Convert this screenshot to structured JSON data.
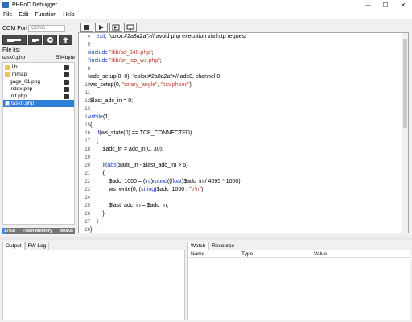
{
  "window": {
    "title": "PHPoC Debugger",
    "controls": {
      "minimize": "—",
      "maximize": "☐",
      "close": "✕"
    }
  },
  "menu": [
    "File",
    "Edit",
    "Function",
    "Help"
  ],
  "sidebar": {
    "com_port_label": "COM Port",
    "com_port_value": "COM5",
    "file_list_label": "File list",
    "project_name": "task0.php",
    "project_size": "534byte",
    "tree": [
      {
        "label": "lib",
        "type": "folder"
      },
      {
        "label": "mmap",
        "type": "folder"
      },
      {
        "label": "gage_01.png",
        "type": "file"
      },
      {
        "label": "index.php",
        "type": "file"
      },
      {
        "label": "init.php",
        "type": "file"
      },
      {
        "label": "task0.php",
        "type": "file",
        "selected": true
      }
    ],
    "memory": {
      "used": "17KB",
      "label": "Flash Memory",
      "total": "460KB",
      "used_fraction": 0.04
    }
  },
  "editor": {
    "lines": [
      {
        "n": "4",
        "code": "    exit; // avoid php execution via http request"
      },
      {
        "n": "5",
        "code": ""
      },
      {
        "n": "6",
        "code": "include \"/lib/sd_340.php\";"
      },
      {
        "n": "7",
        "code": "include \"/lib/sn_tcp_ws.php\";"
      },
      {
        "n": "8",
        "code": ""
      },
      {
        "n": "9",
        "code": "adc_setup(0, 0); // adc0, channel 0"
      },
      {
        "n": "10",
        "code": "ws_setup(0, \"rotary_angle\", \"csv.phpoc\");"
      },
      {
        "n": "11",
        "code": ""
      },
      {
        "n": "12",
        "code": "$last_adc_in = 0;"
      },
      {
        "n": "13",
        "code": ""
      },
      {
        "n": "14",
        "code": "while(1)"
      },
      {
        "n": "15",
        "code": "{"
      },
      {
        "n": "16",
        "code": "    if(ws_state(0) == TCP_CONNECTED)"
      },
      {
        "n": "17",
        "code": "    {"
      },
      {
        "n": "18",
        "code": "        $adc_in = adc_in(0, 30);"
      },
      {
        "n": "19",
        "code": ""
      },
      {
        "n": "20",
        "code": "        if(abs($adc_in - $last_adc_in) > 5)"
      },
      {
        "n": "21",
        "code": "        {"
      },
      {
        "n": "22",
        "code": "            $adc_1000 = (int)round((float)$adc_in / 4095 * 1000);"
      },
      {
        "n": "23",
        "code": "            ws_write(0, (string)$adc_1000 . \"\\r\\n\");"
      },
      {
        "n": "24",
        "code": ""
      },
      {
        "n": "25",
        "code": "            $last_adc_in = $adc_in;"
      },
      {
        "n": "26",
        "code": "        }"
      },
      {
        "n": "27",
        "code": "    }"
      },
      {
        "n": "28",
        "code": "}"
      }
    ]
  },
  "bottom_left_tabs": [
    "Output",
    "FW Log"
  ],
  "bottom_right_tabs": [
    "Watch",
    "Resource"
  ],
  "watch_columns": [
    "Name",
    "Type",
    "Value"
  ]
}
